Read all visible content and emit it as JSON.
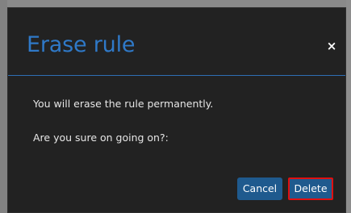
{
  "dialog": {
    "title": "Erase rule",
    "close_label": "×",
    "messages": [
      "You will erase the rule permanently.",
      "Are you sure on going on?:"
    ],
    "buttons": {
      "cancel_label": "Cancel",
      "delete_label": "Delete"
    }
  },
  "colors": {
    "dialog_background": "#222222",
    "title": "#2f79c8",
    "header_divider": "#2f6fb5",
    "button_background": "#1f5a8e",
    "highlight_border": "#e01010",
    "backdrop": "#7c7c7c"
  },
  "icons": {
    "close": "close-icon"
  }
}
